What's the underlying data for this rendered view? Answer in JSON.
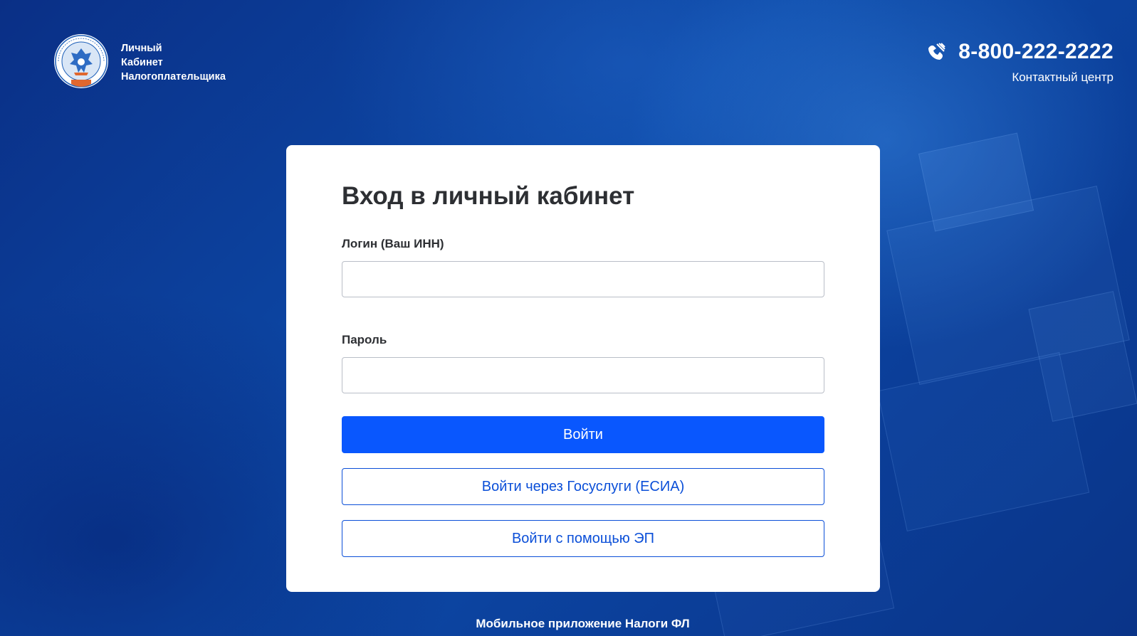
{
  "header": {
    "brand_lines": [
      "Личный",
      "Кабинет",
      "Налогоплательщика"
    ],
    "logo_icon": "fns-emblem-icon",
    "phone_icon": "phone-hands-icon",
    "phone_number": "8-800-222-2222",
    "contact_label": "Контактный центр"
  },
  "login": {
    "title": "Вход в личный кабинет",
    "login_label": "Логин (Ваш ИНН)",
    "login_value": "",
    "password_label": "Пароль",
    "password_value": "",
    "submit_label": "Войти",
    "gosuslugi_label": "Войти через Госуслуги (ЕСИА)",
    "ep_label": "Войти с помощью ЭП"
  },
  "footer": {
    "mobile_app_label": "Мобильное приложение Налоги ФЛ"
  },
  "colors": {
    "background": "#0d4aa8",
    "primary_button": "#0957fe",
    "outline_button": "#0b4fd8",
    "card": "#ffffff",
    "title_text": "#2d2f33"
  }
}
